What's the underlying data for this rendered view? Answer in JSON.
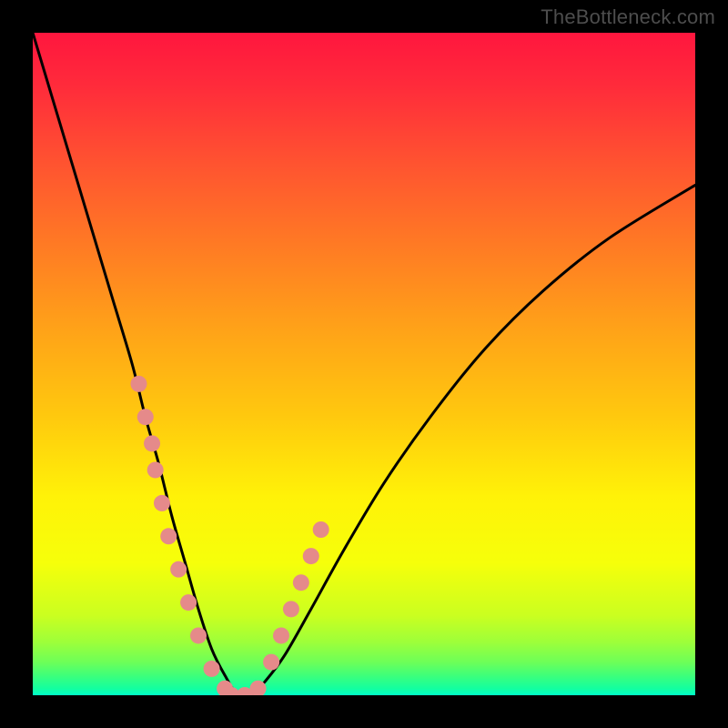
{
  "watermark": "TheBottleneck.com",
  "colors": {
    "frame": "#000000",
    "curve": "#000000",
    "dots": "#e58a8a"
  },
  "chart_data": {
    "type": "line",
    "title": "",
    "xlabel": "",
    "ylabel": "",
    "xlim": [
      0,
      100
    ],
    "ylim": [
      0,
      100
    ],
    "grid": false,
    "legend": false,
    "annotations": [
      "TheBottleneck.com"
    ],
    "series": [
      {
        "name": "bottleneck-curve",
        "x": [
          0,
          3,
          6,
          9,
          12,
          15,
          17,
          19,
          21,
          23,
          25,
          27,
          29,
          31,
          33,
          35,
          38,
          42,
          47,
          53,
          60,
          68,
          77,
          87,
          100
        ],
        "y": [
          100,
          90,
          80,
          70,
          60,
          50,
          42,
          35,
          27,
          20,
          13,
          7,
          3,
          0,
          0,
          2,
          6,
          13,
          22,
          32,
          42,
          52,
          61,
          69,
          77
        ]
      }
    ],
    "points": [
      {
        "name": "left-cluster",
        "x": [
          16,
          17,
          18,
          18.5,
          19.5,
          20.5,
          22,
          23.5,
          25,
          27,
          29
        ],
        "y": [
          47,
          42,
          38,
          34,
          29,
          24,
          19,
          14,
          9,
          4,
          1
        ]
      },
      {
        "name": "bottom-cluster",
        "x": [
          30,
          32,
          34
        ],
        "y": [
          0,
          0,
          1
        ]
      },
      {
        "name": "right-cluster",
        "x": [
          36,
          37.5,
          39,
          40.5,
          42,
          43.5
        ],
        "y": [
          5,
          9,
          13,
          17,
          21,
          25
        ]
      }
    ],
    "minimum_x": 32,
    "description": "V-shaped bottleneck curve over vertical rainbow gradient; minimum near x≈32% of width; pink sample dots clustered along lower arms and valley."
  }
}
